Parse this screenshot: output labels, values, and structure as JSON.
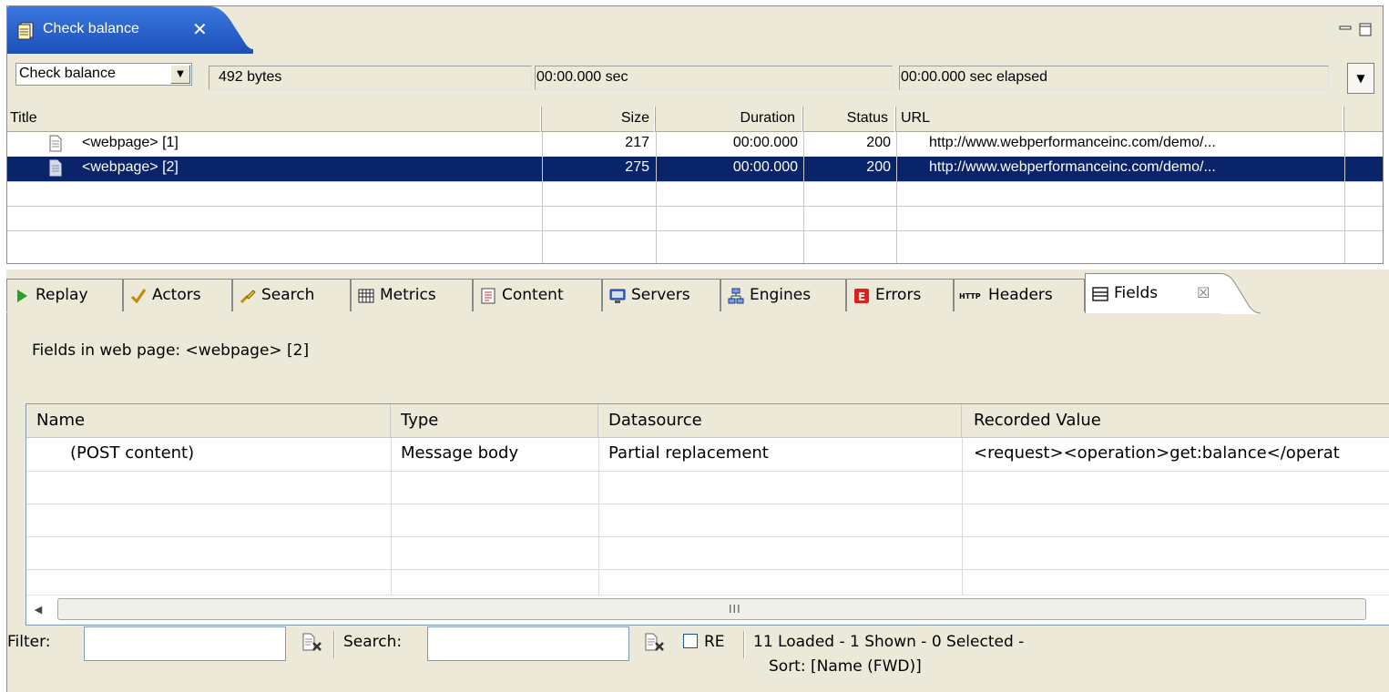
{
  "editor": {
    "tab_title": "Check balance",
    "tab_close": "✕",
    "combo_value": "Check balance",
    "size_field": "492 bytes",
    "time_field": "00:00.000 sec",
    "elapsed_field": "00:00.000 sec elapsed",
    "table": {
      "columns": [
        "Title",
        "Size",
        "Duration",
        "Status",
        "URL"
      ],
      "rows": [
        {
          "title": "<webpage> [1]",
          "size": "217",
          "duration": "00:00.000",
          "status": "200",
          "url": "http://www.webperformanceinc.com/demo/..."
        },
        {
          "title": "<webpage> [2]",
          "size": "275",
          "duration": "00:00.000",
          "status": "200",
          "url": "http://www.webperformanceinc.com/demo/..."
        }
      ],
      "selected_row": 1
    }
  },
  "view": {
    "tabs": [
      {
        "label": "Replay",
        "icon": "play-icon"
      },
      {
        "label": "Actors",
        "icon": "checkmark-icon"
      },
      {
        "label": "Search",
        "icon": "search-icon"
      },
      {
        "label": "Metrics",
        "icon": "metrics-icon"
      },
      {
        "label": "Content",
        "icon": "content-icon"
      },
      {
        "label": "Servers",
        "icon": "servers-icon"
      },
      {
        "label": "Engines",
        "icon": "engines-icon"
      },
      {
        "label": "Errors",
        "icon": "errors-icon"
      },
      {
        "label": "Headers",
        "icon": "http-icon"
      },
      {
        "label": "Fields",
        "icon": "fields-icon"
      }
    ],
    "active_tab": "Fields",
    "http_icon_text": "HTTP",
    "errors_icon_text": "E",
    "fields_close": "☒",
    "caption": "Fields in web page: <webpage> [2]",
    "fields_table": {
      "columns": [
        "Name",
        "Type",
        "Datasource",
        "Recorded Value"
      ],
      "rows": [
        {
          "name": "(POST content)",
          "type": "Message body",
          "datasource": "Partial replacement",
          "recorded_value": "<request><operation>get:balance</operat"
        }
      ]
    },
    "scrollbar_grip": "III",
    "filter_label": "Filter:",
    "filter_value": "",
    "search_label": "Search:",
    "search_value": "",
    "re_label": "RE",
    "re_checked": false,
    "status_line1": "11 Loaded - 1 Shown - 0 Selected -",
    "status_line2": "Sort: [Name (FWD)]"
  },
  "colors": {
    "selection": "#0a246a",
    "tab_active": "#1c5ad6",
    "chrome": "#ece9d8"
  }
}
